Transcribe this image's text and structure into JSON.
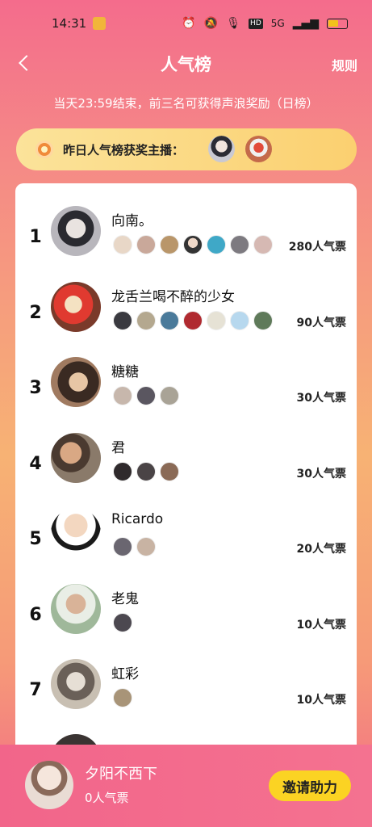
{
  "status_bar": {
    "time": "14:31",
    "network": "5G",
    "icons": [
      "alarm-icon",
      "mute-icon",
      "mic-icon",
      "hd-icon",
      "signal-icon",
      "battery-icon"
    ]
  },
  "header": {
    "title": "人气榜",
    "rules_label": "规则",
    "back_icon": "chevron-left-icon"
  },
  "notice": "当天23:59结束，前三名可获得声浪奖励（日榜）",
  "yesterday_winners": {
    "label": "昨日人气榜获奖主播：",
    "icon": "medal-icon"
  },
  "ranking": [
    {
      "rank": "1",
      "name": "向南。",
      "votes": "280人气票",
      "supporter_count": 7
    },
    {
      "rank": "2",
      "name": "龙舌兰喝不醉的少女",
      "votes": "90人气票",
      "supporter_count": 7
    },
    {
      "rank": "3",
      "name": "糖糖",
      "votes": "30人气票",
      "supporter_count": 3
    },
    {
      "rank": "4",
      "name": "君",
      "votes": "30人气票",
      "supporter_count": 3
    },
    {
      "rank": "5",
      "name": "Ricardo",
      "votes": "20人气票",
      "supporter_count": 2
    },
    {
      "rank": "6",
      "name": "老鬼",
      "votes": "10人气票",
      "supporter_count": 1
    },
    {
      "rank": "7",
      "name": "虹彩",
      "votes": "10人气票",
      "supporter_count": 1
    }
  ],
  "me": {
    "name": "夕阳不西下",
    "votes": "0人气票",
    "invite_label": "邀请助力"
  },
  "colors": {
    "accent_pink": "#f2658a",
    "gradient_orange": "#f7b274",
    "winner_bar": "#fbd070",
    "invite_button": "#fbd323"
  }
}
